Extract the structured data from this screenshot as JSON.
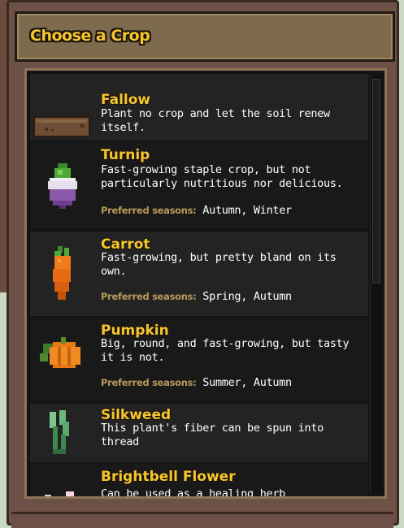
{
  "dialog": {
    "title": "Choose a Crop"
  },
  "crops": [
    {
      "name": "Fallow",
      "description": "Plant no crop and let the soil renew itself.",
      "icon": "soil-patch-icon"
    },
    {
      "name": "Turnip",
      "description": "Fast-growing staple crop, but not particularly nutritious nor delicious.",
      "seasons_label": "Preferred seasons:",
      "seasons": "Autumn, Winter",
      "icon": "turnip-icon"
    },
    {
      "name": "Carrot",
      "description": "Fast-growing, but pretty bland on its own.",
      "seasons_label": "Preferred seasons:",
      "seasons": "Spring, Autumn",
      "icon": "carrot-icon"
    },
    {
      "name": "Pumpkin",
      "description": "Big, round, and fast-growing, but tasty it is not.",
      "seasons_label": "Preferred seasons:",
      "seasons": "Summer, Autumn",
      "icon": "pumpkin-icon"
    },
    {
      "name": "Silkweed",
      "description": "This plant's fiber can be spun into thread",
      "icon": "silkweed-icon"
    },
    {
      "name": "Brightbell Flower",
      "description": "Can be used as a healing herb",
      "icon": "brightbell-flower-icon"
    }
  ],
  "colors": {
    "title": "#f6c72b",
    "label": "#b99a5a",
    "frame": "#6e5146"
  }
}
